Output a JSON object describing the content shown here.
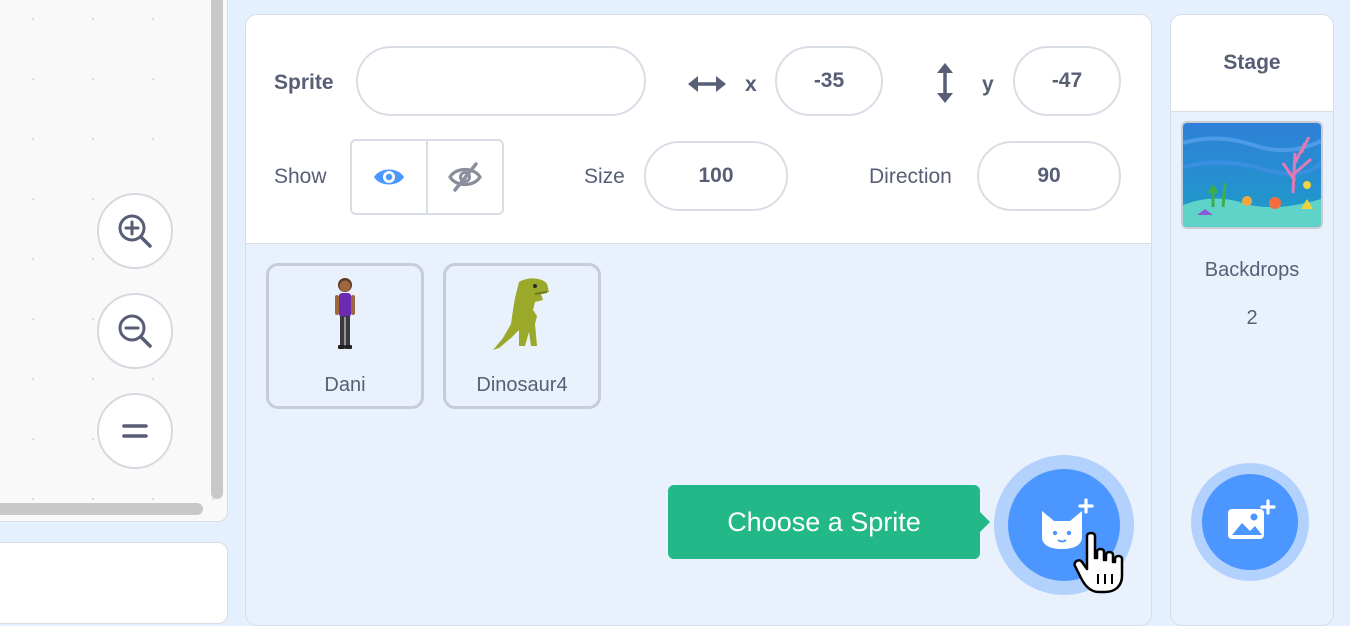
{
  "sprite_info": {
    "sprite_label": "Sprite",
    "sprite_name_value": "",
    "x_label": "x",
    "x_value": "-35",
    "y_label": "y",
    "y_value": "-47",
    "show_label": "Show",
    "size_label": "Size",
    "size_value": "100",
    "direction_label": "Direction",
    "direction_value": "90"
  },
  "sprites": [
    {
      "name": "Dani"
    },
    {
      "name": "Dinosaur4"
    }
  ],
  "tooltip": {
    "text": "Choose a Sprite"
  },
  "stage": {
    "title": "Stage",
    "backdrops_label": "Backdrops",
    "backdrops_count": "2"
  },
  "colors": {
    "accent": "#4c97ff",
    "tooltip_green": "#22b887",
    "text": "#575e75",
    "panel_bg": "#e9f1fc"
  },
  "icons": {
    "zoom_in": "zoom-in-icon",
    "zoom_out": "zoom-out-icon",
    "zoom_reset": "zoom-reset-icon",
    "show": "eye-icon",
    "hide": "eye-slash-icon",
    "choose_sprite": "cat-plus-icon",
    "choose_backdrop": "image-plus-icon"
  }
}
